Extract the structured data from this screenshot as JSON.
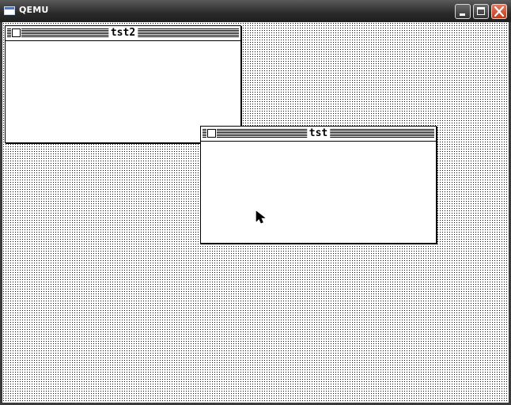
{
  "host_window": {
    "title": "QEMU",
    "icon": "app-window-icon",
    "controls": {
      "minimize_icon": "minimize-icon",
      "maximize_icon": "maximize-icon",
      "close_icon": "close-icon"
    }
  },
  "guest": {
    "desktop_pattern": "dotted-gray",
    "windows": [
      {
        "title": "tst2",
        "active": false
      },
      {
        "title": "tst",
        "active": true
      }
    ],
    "cursor_icon": "arrow-pointer-icon"
  }
}
